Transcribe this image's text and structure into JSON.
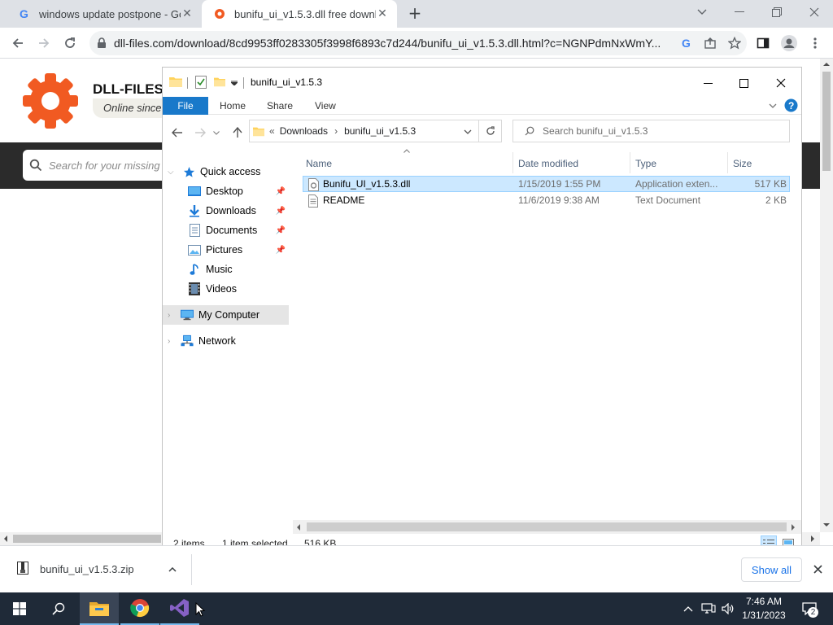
{
  "browser": {
    "tabs": [
      {
        "title": "windows update postpone - Goo"
      },
      {
        "title": "bunifu_ui_v1.5.3.dll free downloa"
      }
    ],
    "url": "dll-files.com/download/8cd9953ff0283305f3998f6893c7d244/bunifu_ui_v1.5.3.dll.html?c=NGNPdmNxWmY..."
  },
  "site": {
    "logo_text": "DLL-FILES.",
    "tagline": "Online since",
    "search_placeholder": "Search for your missing"
  },
  "explorer": {
    "title": "bunifu_ui_v1.5.3",
    "ribbon_tabs": [
      "File",
      "Home",
      "Share",
      "View"
    ],
    "breadcrumb": {
      "prefix": "«",
      "parts": [
        "Downloads",
        "bunifu_ui_v1.5.3"
      ]
    },
    "search_placeholder": "Search bunifu_ui_v1.5.3",
    "nav": {
      "quick_access": "Quick access",
      "items": [
        "Desktop",
        "Downloads",
        "Documents",
        "Pictures",
        "Music",
        "Videos"
      ],
      "my_computer": "My Computer",
      "network": "Network"
    },
    "columns": [
      "Name",
      "Date modified",
      "Type",
      "Size"
    ],
    "files": [
      {
        "name": "Bunifu_UI_v1.5.3.dll",
        "date": "1/15/2019 1:55 PM",
        "type": "Application exten...",
        "size": "517 KB",
        "selected": true
      },
      {
        "name": "README",
        "date": "11/6/2019 9:38 AM",
        "type": "Text Document",
        "size": "2 KB",
        "selected": false
      }
    ],
    "status": {
      "items": "2 items",
      "selected": "1 item selected",
      "size": "516 KB"
    }
  },
  "downloads_shelf": {
    "file": "bunifu_ui_v1.5.3.zip",
    "show_all": "Show all"
  },
  "taskbar": {
    "time": "7:46 AM",
    "date": "1/31/2023",
    "notifications": "2"
  },
  "colors": {
    "accent": "#1979ca",
    "selection": "#cce8ff",
    "brand_orange": "#f15a22",
    "taskbar": "#1f2a38"
  }
}
